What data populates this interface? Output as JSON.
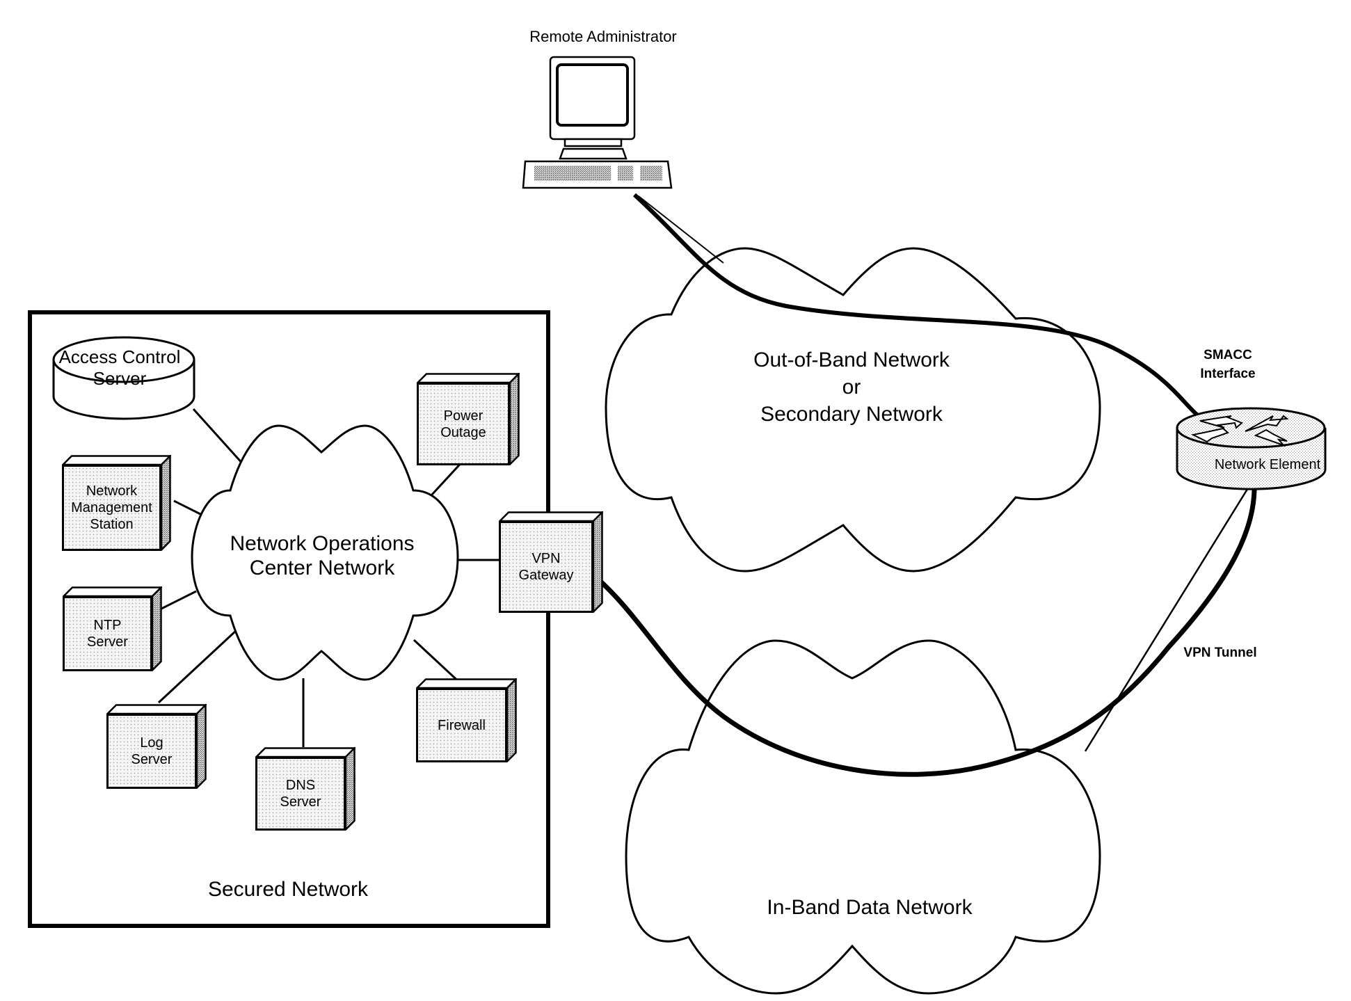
{
  "diagram": {
    "remote_admin": {
      "label": "Remote Administrator",
      "icon": "computer-icon"
    },
    "secured_network": {
      "label": "Secured Network"
    },
    "noc_network": {
      "line1": "Network Operations",
      "line2": "Center Network",
      "icon": "cloud-icon"
    },
    "out_of_band": {
      "line1": "Out-of-Band Network",
      "line2": "or",
      "line3": "Secondary Network",
      "icon": "cloud-icon"
    },
    "in_band": {
      "label": "In-Band Data Network",
      "icon": "cloud-icon"
    },
    "network_element": {
      "label": "Network Element",
      "icon": "router-icon"
    },
    "smacc": {
      "line1": "SMACC",
      "line2": "Interface"
    },
    "vpn_tunnel": {
      "label": "VPN Tunnel"
    },
    "devices": {
      "access_control": {
        "line1": "Access Control",
        "line2": "Server",
        "icon": "database-icon"
      },
      "power_outage": {
        "line1": "Power",
        "line2": "Outage",
        "icon": "server-box-icon"
      },
      "nms": {
        "line1": "Network",
        "line2": "Management",
        "line3": "Station",
        "icon": "server-box-icon"
      },
      "ntp": {
        "line1": "NTP",
        "line2": "Server",
        "icon": "server-box-icon"
      },
      "log": {
        "line1": "Log",
        "line2": "Server",
        "icon": "server-box-icon"
      },
      "dns": {
        "line1": "DNS",
        "line2": "Server",
        "icon": "server-box-icon"
      },
      "firewall": {
        "line1": "Firewall",
        "icon": "server-box-icon"
      },
      "vpn_gateway": {
        "line1": "VPN",
        "line2": "Gateway",
        "icon": "server-box-icon"
      }
    }
  }
}
